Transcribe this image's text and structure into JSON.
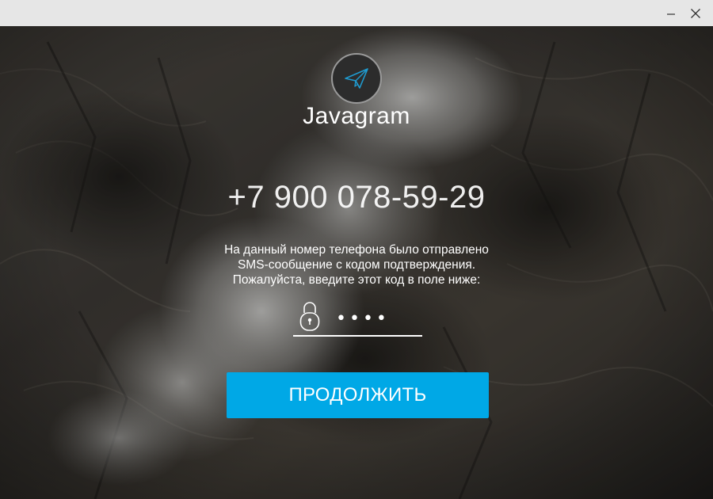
{
  "window": {
    "minimize_glyph": "–",
    "close_glyph": "×"
  },
  "app": {
    "name": "Javagram",
    "logo_icon": "paper-plane-icon"
  },
  "login": {
    "phone": "+7 900 078-59-29",
    "info_lines": [
      "На данный номер телефона было отправлено",
      "SMS-сообщение с кодом подтверждения.",
      "Пожалуйста, введите этот код в поле ниже:"
    ],
    "code_value": "••••",
    "code_icon": "lock-icon",
    "continue_label": "ПРОДОЛЖИТЬ"
  },
  "colors": {
    "accent": "#00a8e6",
    "titlebar": "#e6e6e6",
    "logo_plane": "#1f9bd0"
  }
}
